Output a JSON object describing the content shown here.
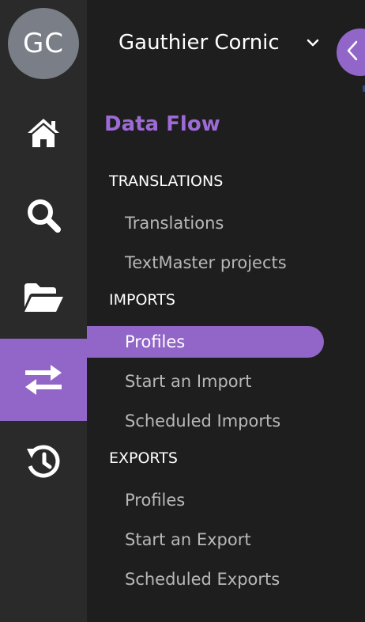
{
  "user": {
    "initials": "GC",
    "name": "Gauthier Cornic"
  },
  "rail": {
    "items": [
      {
        "name": "home",
        "icon": "home-icon",
        "active": false
      },
      {
        "name": "search",
        "icon": "search-icon",
        "active": false
      },
      {
        "name": "folders",
        "icon": "folder-open-icon",
        "active": false
      },
      {
        "name": "data-flow",
        "icon": "exchange-arrows-icon",
        "active": true
      },
      {
        "name": "history",
        "icon": "history-icon",
        "active": false
      }
    ]
  },
  "panel": {
    "title": "Data Flow",
    "groups": [
      {
        "heading": "TRANSLATIONS",
        "items": [
          "Translations",
          "TextMaster projects"
        ]
      },
      {
        "heading": "IMPORTS",
        "items": [
          "Profiles",
          "Start an Import",
          "Scheduled Imports"
        ]
      },
      {
        "heading": "EXPORTS",
        "items": [
          "Profiles",
          "Start an Export",
          "Scheduled Exports"
        ]
      }
    ],
    "active_item": "IMPORTS / Profiles"
  },
  "colors": {
    "rail_bg": "#2a2a2a",
    "panel_bg": "#1e1e1e",
    "accent": "#9166c8",
    "title": "#9d6ad6",
    "item_text": "#b8b8b8",
    "avatar_bg": "#7a7f87"
  }
}
